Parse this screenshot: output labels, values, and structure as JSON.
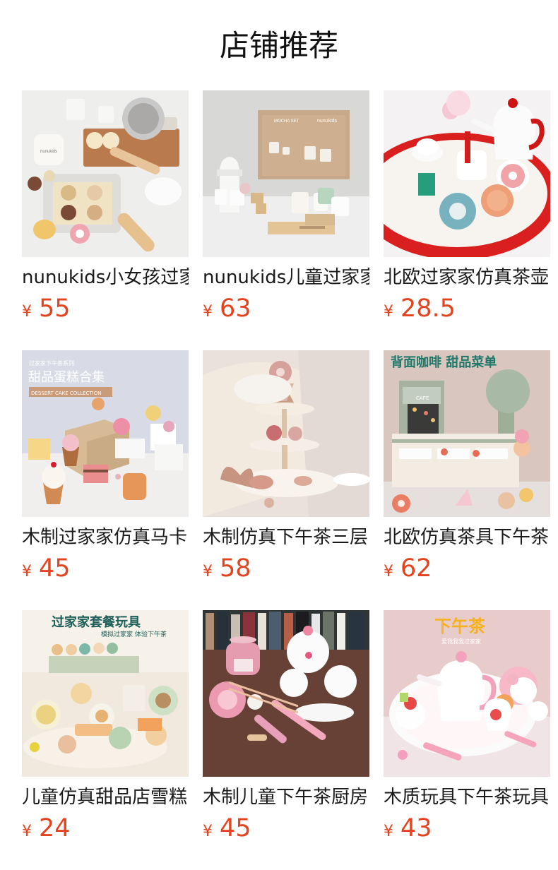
{
  "header": {
    "title": "店铺推荐"
  },
  "currency_symbol": "¥",
  "colors": {
    "price": "#e4431f",
    "title": "#111111",
    "text": "#1a1a1a"
  },
  "products": [
    {
      "name": "nunukids小女孩过家",
      "price": "55",
      "image_icon": "baking-toy-set-image",
      "image_text": "nunukids"
    },
    {
      "name": "nunukids儿童过家家",
      "price": "63",
      "image_icon": "coffee-toy-set-image",
      "image_text": "nunukids",
      "box_text": "MOCHA SET"
    },
    {
      "name": "北欧过家家仿真茶壶",
      "price": "28.5",
      "image_icon": "tea-tray-toy-image"
    },
    {
      "name": "木制过家家仿真马卡",
      "price": "45",
      "image_icon": "dessert-cake-toy-image",
      "banner_small": "过家家下午茶系列",
      "banner_main": "甜品蛋糕合集",
      "banner_caption": "DESSERT CAKE COLLECTION"
    },
    {
      "name": "木制仿真下午茶三层",
      "price": "58",
      "image_icon": "tiered-stand-toy-image"
    },
    {
      "name": "北欧仿真茶具下午茶",
      "price": "62",
      "image_icon": "dessert-menu-toy-image",
      "banner_main": "背面咖啡 甜品菜单",
      "stand_text": "CAFE"
    },
    {
      "name": "儿童仿真甜品店雪糕",
      "price": "24",
      "image_icon": "meal-set-toy-image",
      "banner_main": "过家家套餐玩具",
      "banner_sub": "模拟过家家 体验下午茶"
    },
    {
      "name": "木制儿童下午茶厨房",
      "price": "45",
      "image_icon": "pink-kitchen-toy-image"
    },
    {
      "name": "木质玩具下午茶玩具",
      "price": "43",
      "image_icon": "strawberry-tea-set-image",
      "banner_main": "下午茶",
      "banner_sub": "爱我我我过家家"
    }
  ]
}
